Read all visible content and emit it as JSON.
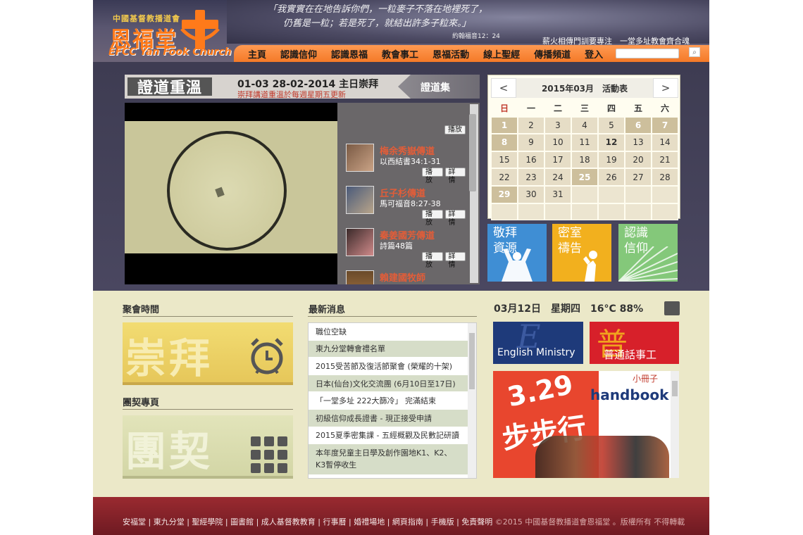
{
  "header": {
    "logo_small": "中國基督教播道會",
    "logo_cn": "恩福堂",
    "logo_en": "EFCC Yan Fook Church",
    "verse_line1": "「我實實在在地告訴你們，一粒麥子不落在地裡死了，",
    "verse_line2": "仍舊是一粒；若是死了，就結出許多子粒來。」",
    "verse_ref": "約翰福音12：24",
    "slogan": "薪火相傳門訓要專注　一堂多址教會齊合魂"
  },
  "nav": {
    "items": [
      "主頁",
      "認識信仰",
      "認識恩福",
      "教會事工",
      "恩福活動",
      "線上聖經",
      "傳播頻道",
      "登入"
    ],
    "search_placeholder": ""
  },
  "sermon": {
    "title": "證道重溫",
    "date": "01-03 28-02-2014 主日崇拜",
    "note": "崇拜講道重溫於每週星期五更新",
    "collection": "證道集",
    "top_play": "播放",
    "items": [
      {
        "speaker": "梅余秀嶽傳道",
        "verse": "以西結書34:1-31",
        "play": "播放",
        "detail": "詳情"
      },
      {
        "speaker": "丘子杉傳道",
        "verse": "馬可福音8:27-38",
        "play": "播放",
        "detail": "詳情"
      },
      {
        "speaker": "秦姜國芳傳道",
        "verse": "詩篇48篇",
        "play": "播放",
        "detail": "詳情"
      },
      {
        "speaker": "賴建國牧師",
        "verse": "",
        "play": "",
        "detail": ""
      }
    ]
  },
  "calendar": {
    "prev": "<",
    "next": ">",
    "title": "2015年03月　活動表",
    "weekdays": [
      "日",
      "一",
      "二",
      "三",
      "四",
      "五",
      "六"
    ],
    "days": [
      "1",
      "2",
      "3",
      "4",
      "5",
      "6",
      "7",
      "8",
      "9",
      "10",
      "11",
      "12",
      "13",
      "14",
      "15",
      "16",
      "17",
      "18",
      "19",
      "20",
      "21",
      "22",
      "23",
      "24",
      "25",
      "26",
      "27",
      "28",
      "29",
      "30",
      "31",
      "",
      "",
      "",
      ""
    ]
  },
  "tiles": {
    "resources": [
      "敬拜",
      "資源"
    ],
    "prayer": [
      "密室",
      "禱告"
    ],
    "faith": [
      "認識",
      "信仰"
    ]
  },
  "colors": {
    "nav_orange": "#f47a28",
    "tile_blue": "#3f8ed4",
    "tile_yellow": "#f2b01e",
    "tile_green": "#84c87a",
    "footer_red": "#8a2028"
  },
  "lower": {
    "meeting_title": "聚會時間",
    "worship_label": "崇拜",
    "fellowship_title": "團契專頁",
    "fellowship_label": "團契",
    "news_title": "最新消息",
    "news": [
      "職位空缺",
      "東九分堂轉會禮名單",
      "2015受苦節及復活節聚會 (榮耀的十架)",
      "日本(仙台)文化交流團 (6月10日至17日)",
      "「一堂多址 222大篩冷」 完滿結束",
      "初級信仰成長證書 - 現正接受申請",
      "2015夏季密集課 - 五經概觀及民數記研讀",
      "本年度兒童主日學及創作園地K1、K2、K3暫停收生"
    ],
    "weather": "03月12日　星期四　16°C 88%",
    "english_ministry": "English Ministry",
    "mandarin_char": "普",
    "mandarin": "普通話事工",
    "handbook_num": "3.29",
    "handbook_steps": "步步行",
    "handbook_small": "小冊子",
    "handbook_word": "handbook"
  },
  "footer": {
    "links": "安福堂 | 東九分堂 | 聖經學院 | 圖書館 | 成人基督教教育 | 行事曆 | 婚禮場地 | 網頁指南 | 手機版 | 免責聲明",
    "copyright": "©2015 中國基督教播道會恩福堂 。版權所有 不得轉載"
  }
}
